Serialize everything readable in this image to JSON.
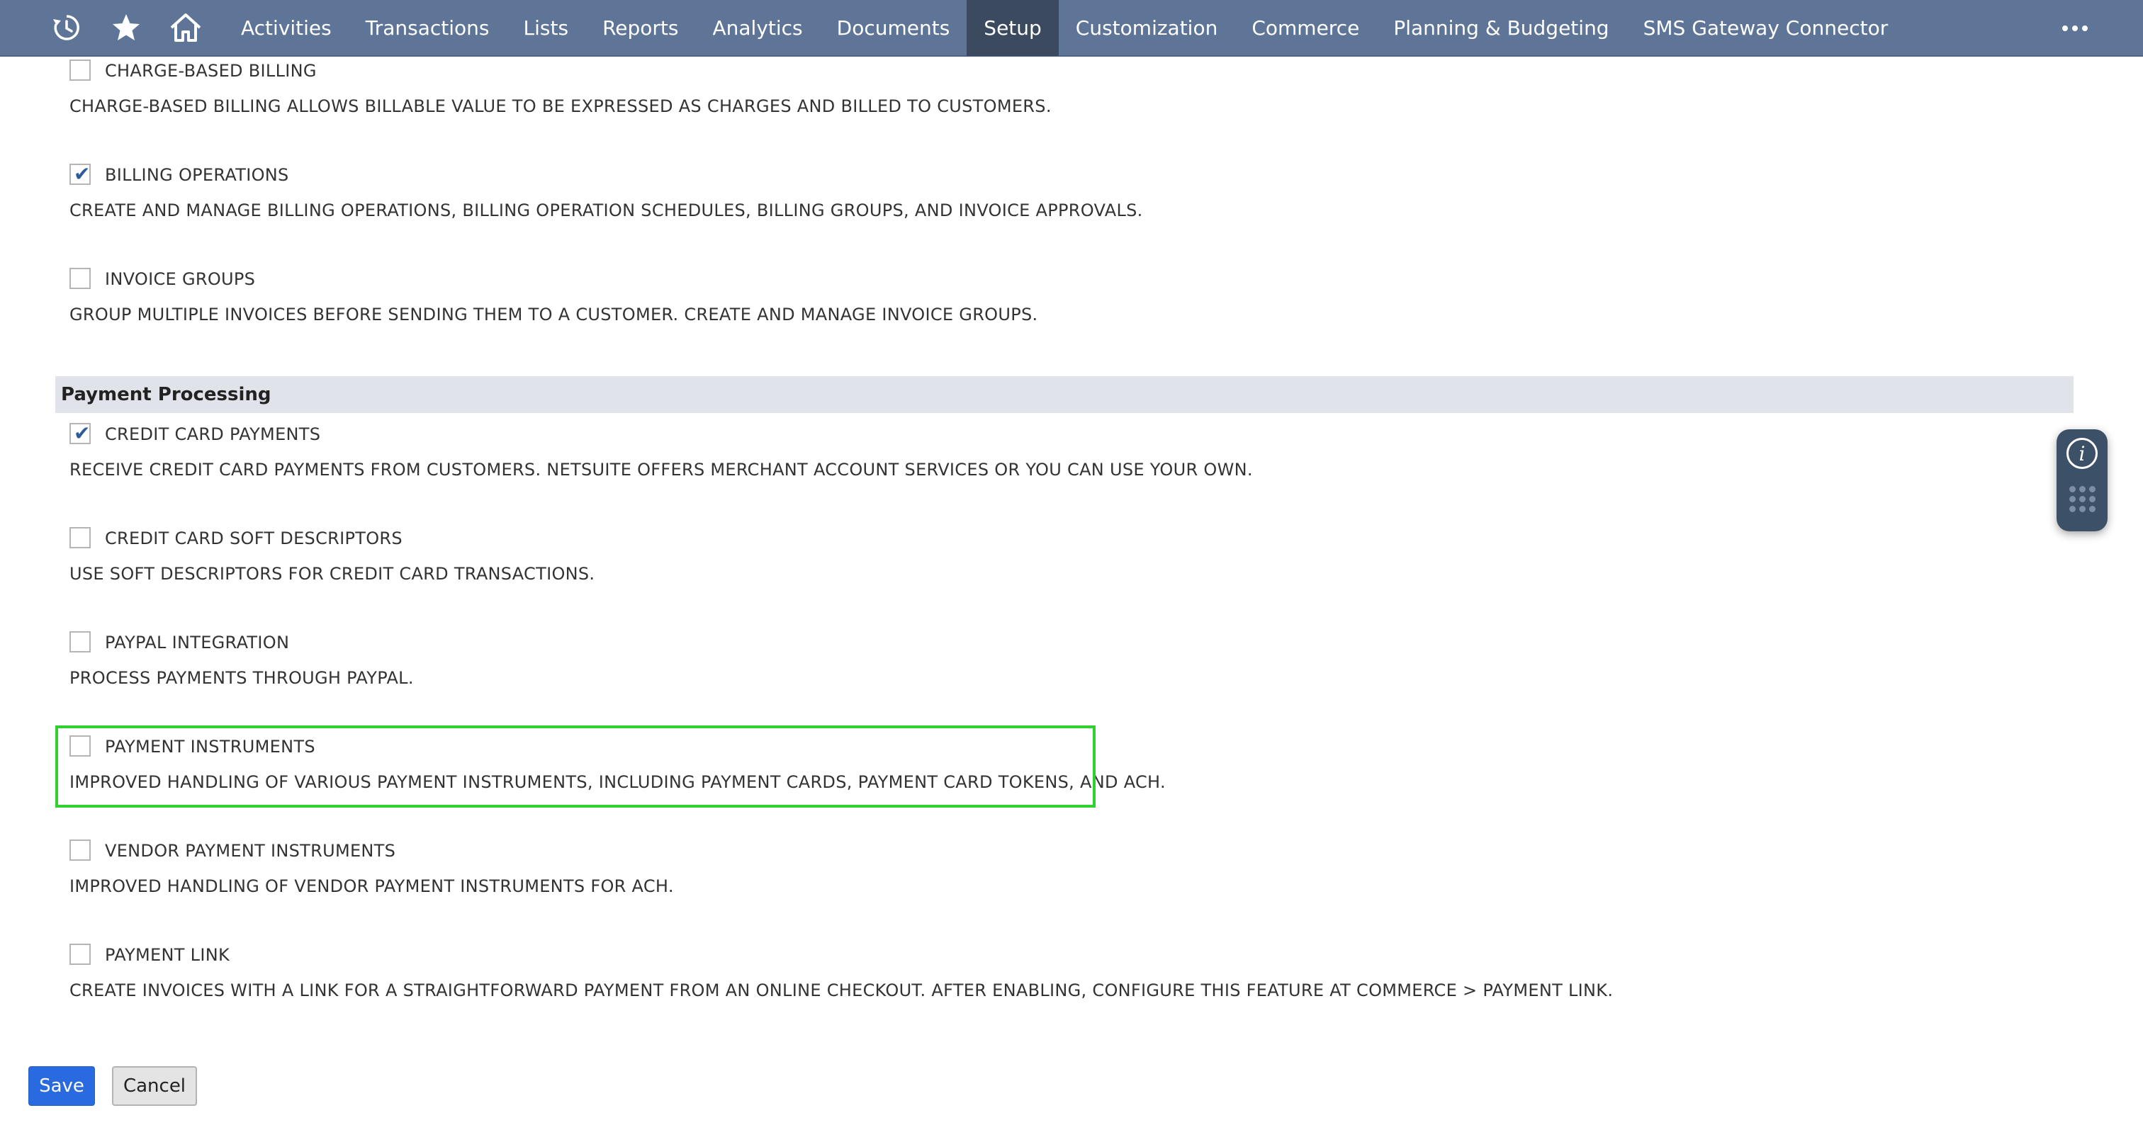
{
  "nav": {
    "icons": [
      "recent-history-icon",
      "star-icon",
      "home-icon"
    ],
    "tabs": [
      {
        "label": "Activities",
        "active": false
      },
      {
        "label": "Transactions",
        "active": false
      },
      {
        "label": "Lists",
        "active": false
      },
      {
        "label": "Reports",
        "active": false
      },
      {
        "label": "Analytics",
        "active": false
      },
      {
        "label": "Documents",
        "active": false
      },
      {
        "label": "Setup",
        "active": true
      },
      {
        "label": "Customization",
        "active": false
      },
      {
        "label": "Commerce",
        "active": false
      },
      {
        "label": "Planning & Budgeting",
        "active": false
      },
      {
        "label": "SMS Gateway Connector",
        "active": false
      }
    ],
    "colors": {
      "bar": "#5f7597",
      "active_tab": "#3c4a60"
    }
  },
  "billing_features": [
    {
      "label": "CHARGE-BASED BILLING",
      "checked": false,
      "description": "CHARGE-BASED BILLING ALLOWS BILLABLE VALUE TO BE EXPRESSED AS CHARGES AND BILLED TO CUSTOMERS."
    },
    {
      "label": "BILLING OPERATIONS",
      "checked": true,
      "description": "CREATE AND MANAGE BILLING OPERATIONS, BILLING OPERATION SCHEDULES, BILLING GROUPS, AND INVOICE APPROVALS."
    },
    {
      "label": "INVOICE GROUPS",
      "checked": false,
      "description": "GROUP MULTIPLE INVOICES BEFORE SENDING THEM TO A CUSTOMER. CREATE AND MANAGE INVOICE GROUPS."
    }
  ],
  "section": {
    "title": "Payment Processing"
  },
  "payment_features": [
    {
      "label": "CREDIT CARD PAYMENTS",
      "checked": true,
      "description": "RECEIVE CREDIT CARD PAYMENTS FROM CUSTOMERS. NETSUITE OFFERS MERCHANT ACCOUNT SERVICES OR YOU CAN USE YOUR OWN."
    },
    {
      "label": "CREDIT CARD SOFT DESCRIPTORS",
      "checked": false,
      "description": "USE SOFT DESCRIPTORS FOR CREDIT CARD TRANSACTIONS."
    },
    {
      "label": "PAYPAL INTEGRATION",
      "checked": false,
      "description": "PROCESS PAYMENTS THROUGH PAYPAL."
    },
    {
      "label": "PAYMENT INSTRUMENTS",
      "checked": false,
      "highlighted": true,
      "description": "IMPROVED HANDLING OF VARIOUS PAYMENT INSTRUMENTS, INCLUDING PAYMENT CARDS, PAYMENT CARD TOKENS, AND ACH."
    },
    {
      "label": "VENDOR PAYMENT INSTRUMENTS",
      "checked": false,
      "description": "IMPROVED HANDLING OF VENDOR PAYMENT INSTRUMENTS FOR ACH."
    },
    {
      "label": "PAYMENT LINK",
      "checked": false,
      "description": "CREATE INVOICES WITH A LINK FOR A STRAIGHTFORWARD PAYMENT FROM AN ONLINE CHECKOUT. AFTER ENABLING, CONFIGURE THIS FEATURE AT COMMERCE > PAYMENT LINK."
    }
  ],
  "buttons": {
    "save": "Save",
    "cancel": "Cancel"
  },
  "widget": {
    "info_glyph": "i",
    "icons": [
      "info-icon",
      "drag-grip-icon"
    ]
  },
  "colors": {
    "highlight_border": "#2ed12e",
    "section_bg": "#e0e4ea",
    "save_bg": "#2a6ae0"
  }
}
